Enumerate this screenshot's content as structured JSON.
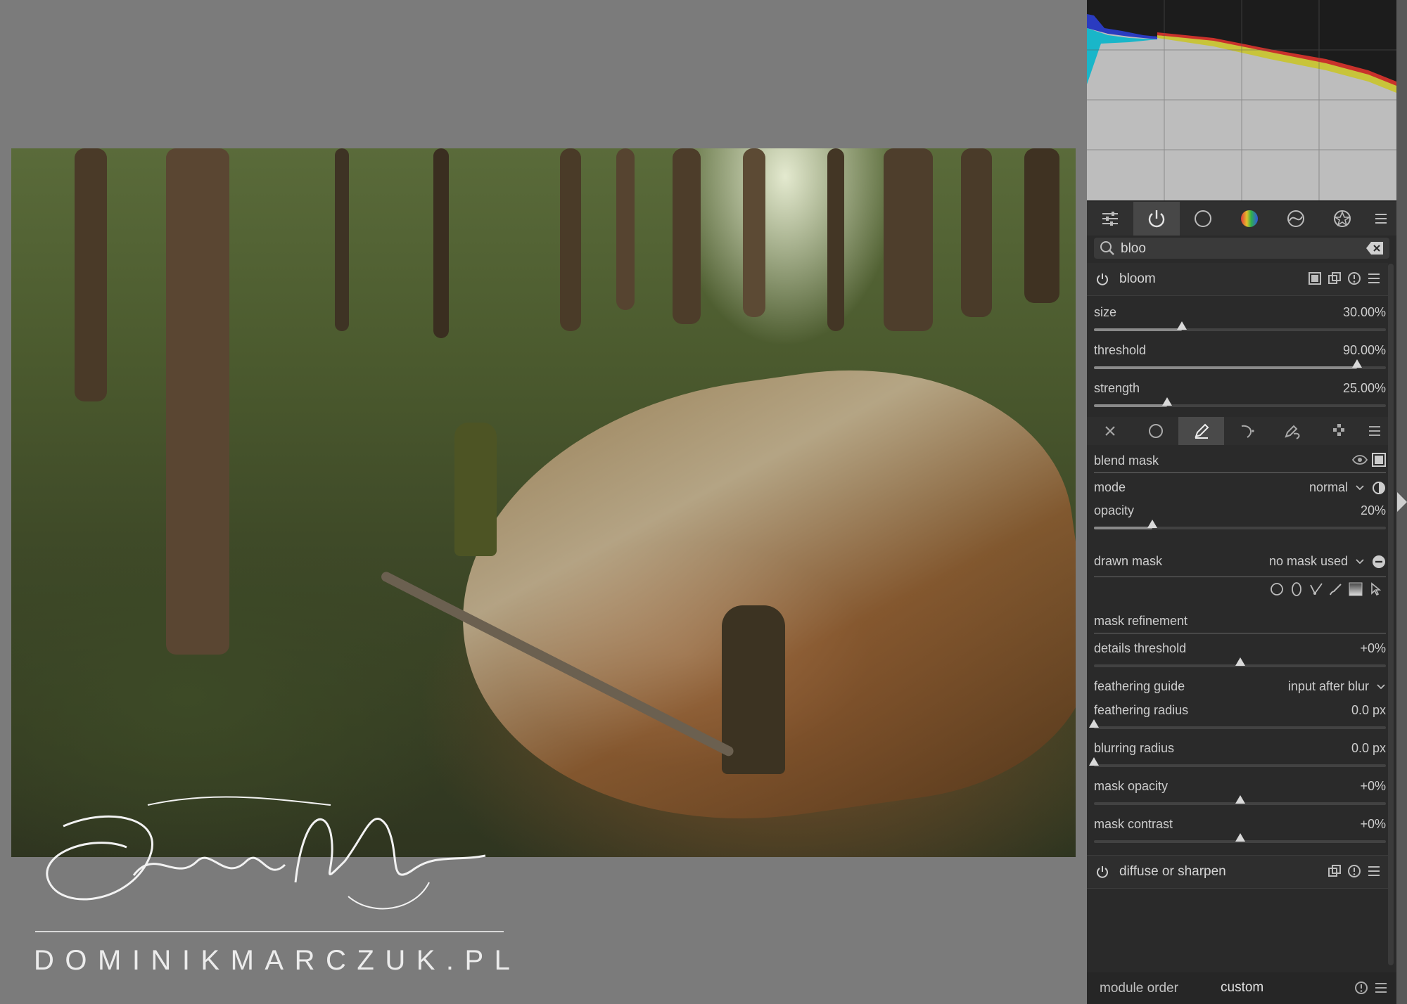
{
  "photo": {
    "signature_text": "Dominik Marczuk",
    "watermark_url": "DOMINIKMARCZUK.PL"
  },
  "histogram": {
    "colors": {
      "blue": "#2a3bc0",
      "cyan": "#19b6c9",
      "red": "#c9312b",
      "yellow": "#c8c43a",
      "background": "#bdbdbd"
    }
  },
  "module_groups": {
    "tabs": [
      {
        "icon": "sliders-icon"
      },
      {
        "icon": "power-icon",
        "active": true
      },
      {
        "icon": "circle-icon"
      },
      {
        "icon": "color-wheel-icon"
      },
      {
        "icon": "correct-icon"
      },
      {
        "icon": "effect-icon"
      },
      {
        "icon": "menu-icon"
      }
    ]
  },
  "search": {
    "value": "bloo"
  },
  "bloom": {
    "title": "bloom",
    "size_label": "size",
    "size_value": "30.00%",
    "size_level": 0.3,
    "threshold_label": "threshold",
    "threshold_value": "90.00%",
    "threshold_level": 0.9,
    "strength_label": "strength",
    "strength_value": "25.00%",
    "strength_level": 0.25
  },
  "blend": {
    "section_title": "blend mask",
    "mode_label": "mode",
    "mode_value": "normal",
    "opacity_label": "opacity",
    "opacity_value": "20%",
    "opacity_level": 0.2,
    "drawn_mask_label": "drawn mask",
    "drawn_mask_value": "no mask used",
    "refinement_title": "mask refinement",
    "details_label": "details threshold",
    "details_value": "+0%",
    "details_level": 0.5,
    "feather_guide_label": "feathering guide",
    "feather_guide_value": "input after blur",
    "feather_radius_label": "feathering radius",
    "feather_radius_value": "0.0 px",
    "feather_radius_level": 0.0,
    "blur_radius_label": "blurring radius",
    "blur_radius_value": "0.0 px",
    "blur_radius_level": 0.0,
    "mask_opacity_label": "mask opacity",
    "mask_opacity_value": "+0%",
    "mask_opacity_level": 0.5,
    "mask_contrast_label": "mask contrast",
    "mask_contrast_value": "+0%",
    "mask_contrast_level": 0.5
  },
  "diffuse": {
    "title": "diffuse or sharpen"
  },
  "footer": {
    "module_order_label": "module order",
    "module_order_value": "custom"
  }
}
